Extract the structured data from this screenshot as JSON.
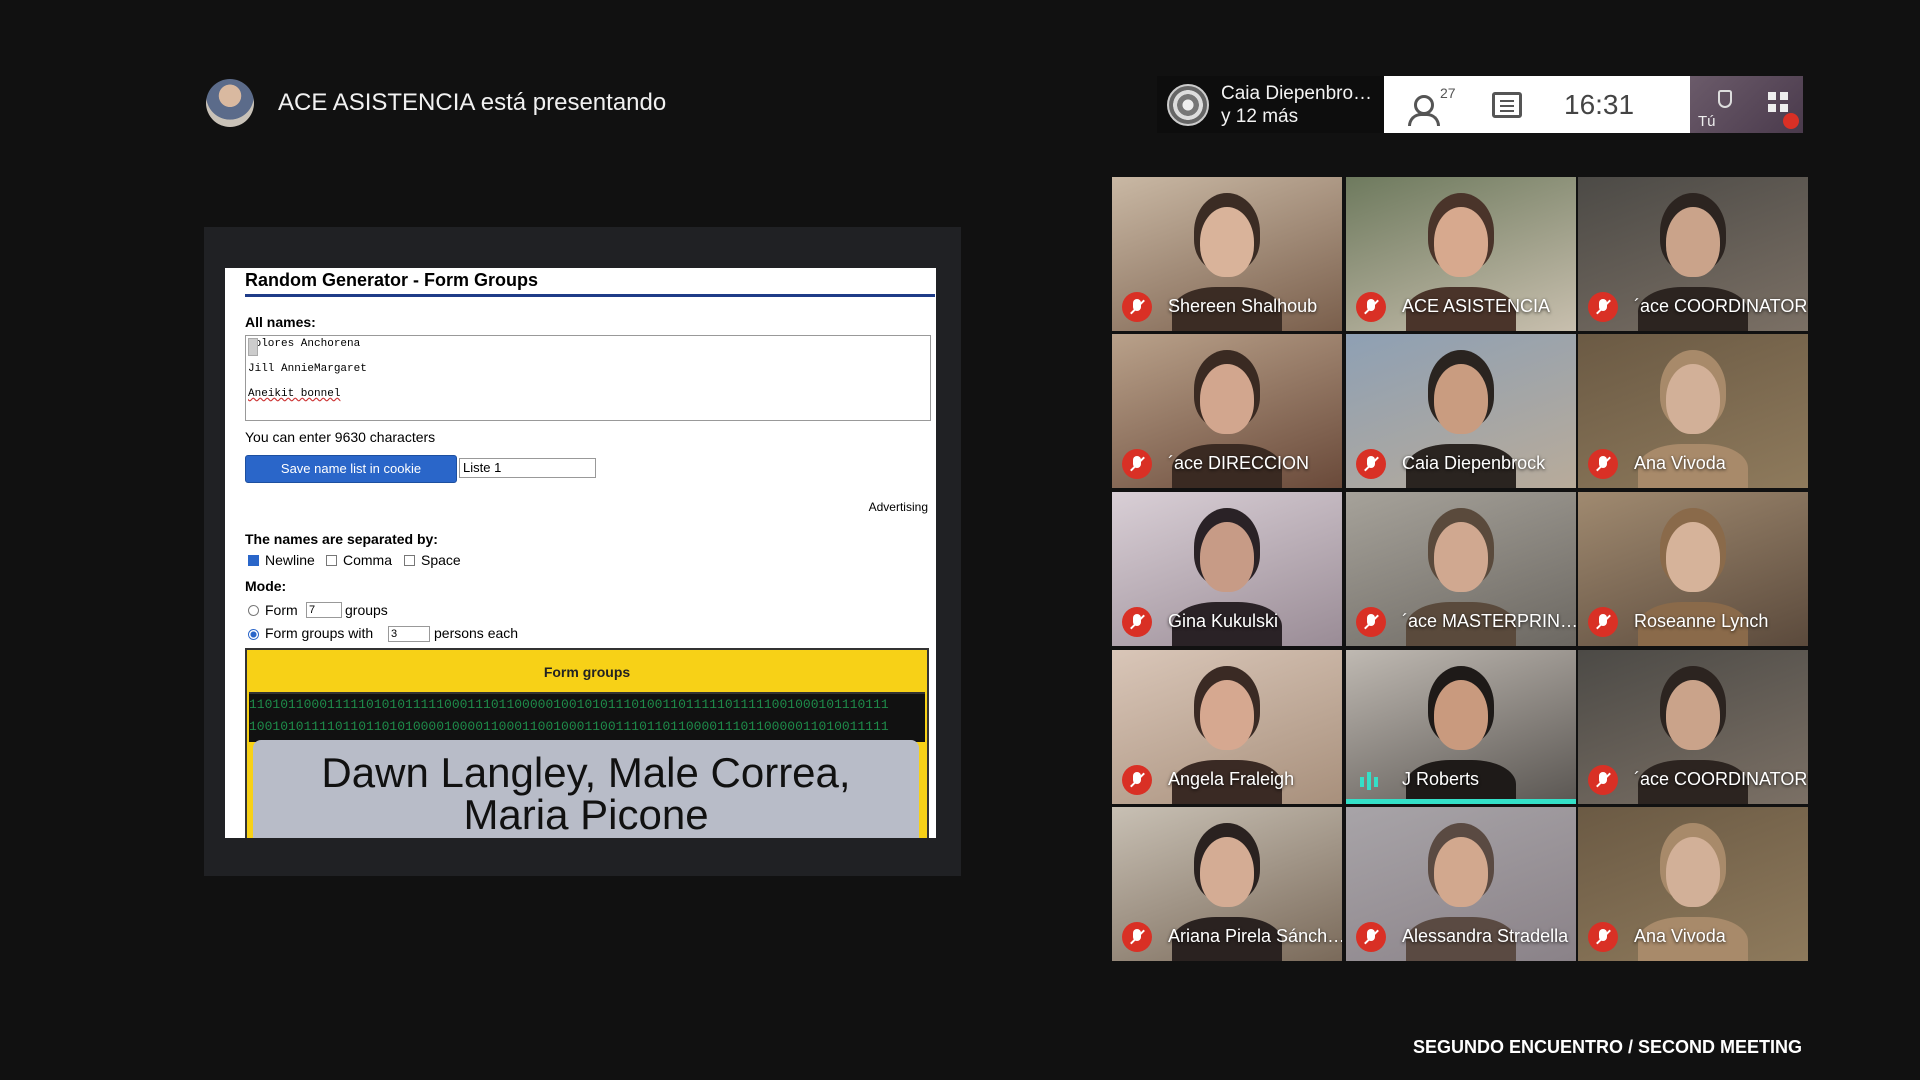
{
  "presenter": {
    "text": "ACE ASISTENCIA está presentando"
  },
  "topbar": {
    "chip_line1": "Caia Diepenbro…",
    "chip_line2": "y 12 más",
    "people_count": "27",
    "time": "16:31",
    "self_label": "Tú"
  },
  "form": {
    "title": "Random Generator - Form Groups",
    "all_names_label": "All names:",
    "names": [
      "Dolores Anchorena",
      "Jill AnnieMargaret",
      "Aneikit bonnel"
    ],
    "chars_left": "You can enter 9630 characters",
    "save_button": "Save name list in cookie",
    "list_name": "Liste 1",
    "advertising": "Advertising",
    "separated_label": "The names are separated by:",
    "sep_newline": "Newline",
    "sep_comma": "Comma",
    "sep_space": "Space",
    "mode_label": "Mode:",
    "mode_form": "Form",
    "groups_count": "7",
    "groups_word": "groups",
    "mode_groups_with": "Form groups with",
    "persons_count": "3",
    "persons_each": "persons each",
    "form_groups_button": "Form groups",
    "binary_line1": "1101011000111110101011111000111011000001001010111010011011111011111001000101110111",
    "binary_line2": "1001010111101101101010000100001100011001000110011101101100001110110000011010011111",
    "result_line1": "Dawn Langley, Male Correa,",
    "result_line2": "Maria Picone"
  },
  "participants": [
    {
      "name": "Shereen Shalhoub",
      "status": "muted"
    },
    {
      "name": "ACE ASISTENCIA",
      "status": "muted"
    },
    {
      "name": "´ace COORDINATOR",
      "status": "muted"
    },
    {
      "name": "´ace DIRECCION",
      "status": "muted"
    },
    {
      "name": "Caia Diepenbrock",
      "status": "muted"
    },
    {
      "name": "Ana Vivoda",
      "status": "muted"
    },
    {
      "name": "Gina Kukulski",
      "status": "muted"
    },
    {
      "name": "´ace MASTERPRIN…",
      "status": "muted"
    },
    {
      "name": "Roseanne Lynch",
      "status": "muted"
    },
    {
      "name": "Angela Fraleigh",
      "status": "muted"
    },
    {
      "name": "J Roberts",
      "status": "speaking"
    },
    {
      "name": "´ace COORDINATOR",
      "status": "muted"
    },
    {
      "name": "Ariana Pirela Sánch…",
      "status": "muted"
    },
    {
      "name": "Alessandra Stradella",
      "status": "muted"
    },
    {
      "name": "Ana Vivoda",
      "status": "muted"
    }
  ],
  "footer": {
    "text": "SEGUNDO ENCUENTRO / SECOND MEETING"
  }
}
